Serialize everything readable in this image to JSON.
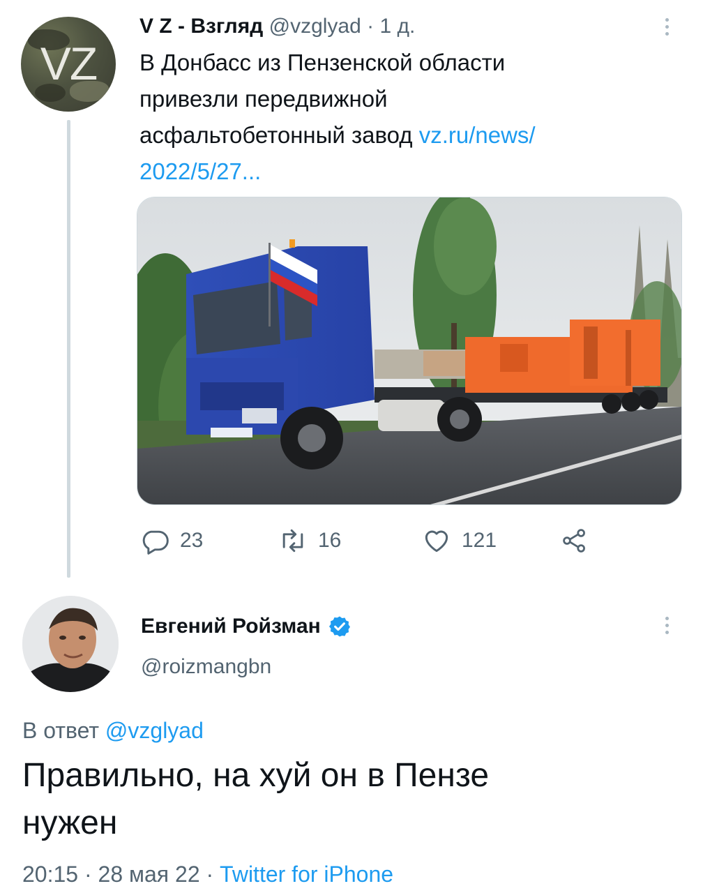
{
  "main_tweet": {
    "avatar_text": "VZ",
    "author_name": "V Z - Взгляд",
    "handle": "@vzglyad",
    "separator": "·",
    "time": "1 д.",
    "text_lines": [
      "В Донбасс из Пензенской области",
      "привезли передвижной",
      "асфальтобетонный завод"
    ],
    "link_part1": "vz.ru/news/",
    "link_part2": "2022/5/27...",
    "media_description": "Blue semi-truck with Russian flag hauling orange asphalt plant equipment",
    "stats": {
      "replies": "23",
      "retweets": "16",
      "likes": "121"
    }
  },
  "reply_tweet": {
    "author_name": "Евгений Ройзман",
    "verified": true,
    "handle": "@roizmangbn",
    "reply_to_prefix": "В ответ",
    "reply_to_handle": "@vzglyad",
    "text_line1": "Правильно, на хуй он в Пензе",
    "text_line2": "нужен",
    "time": "20:15",
    "date": "28 мая 22",
    "dot": "·",
    "source": "Twitter for iPhone"
  },
  "icons": [
    "reply-icon",
    "retweet-icon",
    "like-icon",
    "share-icon",
    "more-icon",
    "verified-icon"
  ],
  "colors": {
    "link": "#1d9bf0",
    "secondary_text": "#536471",
    "thread_line": "#cfd9de"
  }
}
